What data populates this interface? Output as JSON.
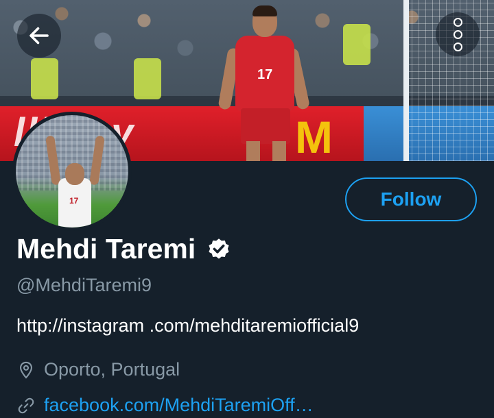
{
  "header": {
    "back_icon": "arrow-left-icon",
    "more_icon": "more-vertical-icon"
  },
  "banner": {
    "board_text": "lliamy",
    "jersey_number": "17"
  },
  "profile": {
    "name": "Mehdi Taremi",
    "verified_icon": "verified-badge-icon",
    "handle": "@MehdiTaremi9",
    "bio": "http://instagram .com/mehditaremiofficial9",
    "location": "Oporto, Portugal",
    "location_icon": "location-pin-icon",
    "website": "facebook.com/MehdiTaremiOff…",
    "website_icon": "link-icon",
    "follow_label": "Follow"
  },
  "colors": {
    "background": "#15202b",
    "accent": "#1da1f2",
    "secondary_text": "#8899a6"
  }
}
